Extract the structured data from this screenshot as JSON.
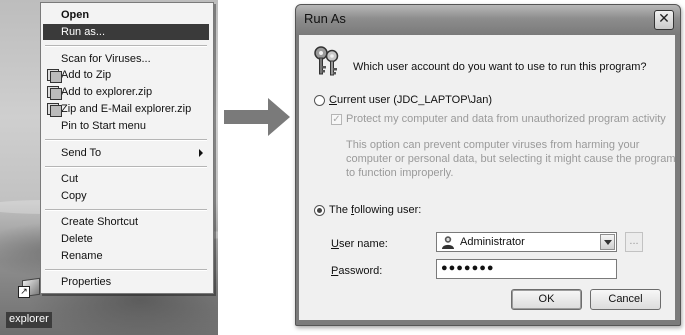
{
  "desktop": {
    "icon_label": "explorer"
  },
  "context_menu": {
    "items": [
      {
        "label": "Open",
        "bold": true
      },
      {
        "label": "Run as...",
        "highlighted": true
      },
      {
        "label": "Scan for Viruses..."
      },
      {
        "label": "Add to Zip",
        "icon": "zip-icon"
      },
      {
        "label": "Add to explorer.zip",
        "icon": "zip-icon"
      },
      {
        "label": "Zip and E-Mail explorer.zip",
        "icon": "zip-icon"
      },
      {
        "label": "Pin to Start menu"
      },
      {
        "label": "Send To",
        "submenu": true
      },
      {
        "label": "Cut"
      },
      {
        "label": "Copy"
      },
      {
        "label": "Create Shortcut"
      },
      {
        "label": "Delete"
      },
      {
        "label": "Rename"
      },
      {
        "label": "Properties"
      }
    ]
  },
  "dialog": {
    "title": "Run As",
    "close_glyph": "✕",
    "question": "Which user account do you want to use to run this program?",
    "current_user_prefix": "C",
    "current_user_rest": "urrent user (JDC_LAPTOP\\Jan)",
    "protect_text": "Protect my computer and data from unauthorized program activity",
    "explain_text": "This option can prevent computer viruses from harming your computer or personal data, but selecting it might cause the program to function improperly.",
    "following_prefix": "The ",
    "following_accel": "f",
    "following_rest": "ollowing user:",
    "username_accel": "U",
    "username_rest": "ser name:",
    "username_value": "Administrator",
    "password_accel": "P",
    "password_rest": "assword:",
    "password_value": "●●●●●●●",
    "browse_label": "...",
    "ok_label": "OK",
    "cancel_label": "Cancel",
    "selected_option": "following_user"
  }
}
